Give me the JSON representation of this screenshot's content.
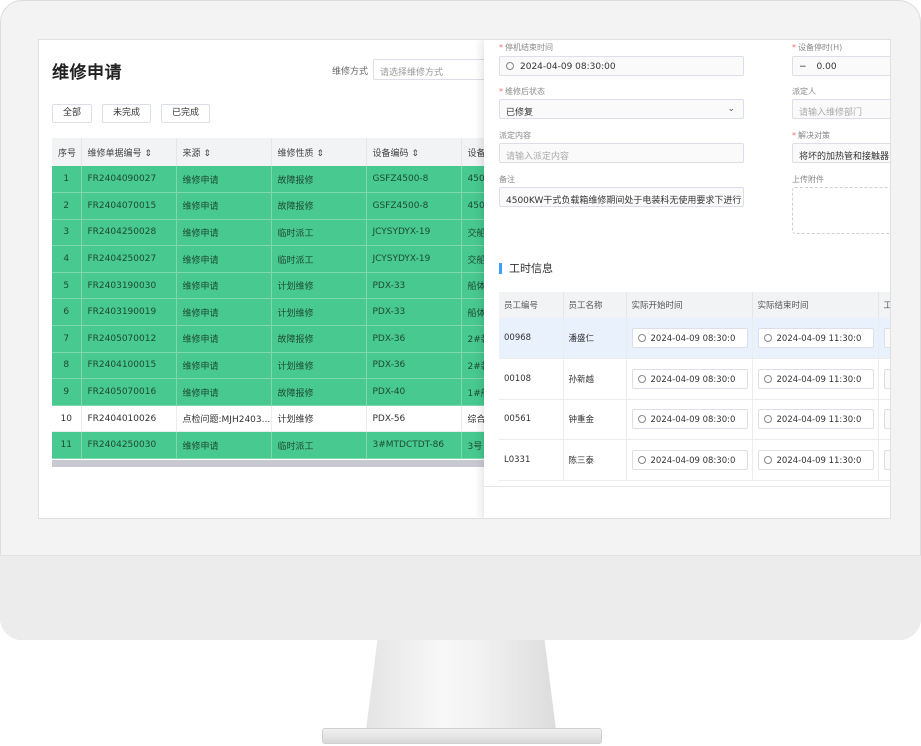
{
  "page": {
    "title": "维修申请",
    "filter_label": "维修方式",
    "filter_placeholder": "请选择维修方式",
    "tabs": [
      "全部",
      "未完成",
      "已完成"
    ]
  },
  "table": {
    "headers": [
      "序号",
      "维修单据编号 ⇕",
      "来源 ⇕",
      "维修性质 ⇕",
      "设备编码 ⇕",
      "设备"
    ],
    "rows": [
      {
        "no": "1",
        "code": "FR2404090027",
        "source": "维修申请",
        "nature": "故障报修",
        "device": "GSFZ4500-8",
        "extra": "4500",
        "color": "green"
      },
      {
        "no": "2",
        "code": "FR2404070015",
        "source": "维修申请",
        "nature": "故障报修",
        "device": "GSFZ4500-8",
        "extra": "4500",
        "color": "green"
      },
      {
        "no": "3",
        "code": "FR2404250028",
        "source": "维修申请",
        "nature": "临时派工",
        "device": "JCYSYDYX-19",
        "extra": "交船",
        "color": "green"
      },
      {
        "no": "4",
        "code": "FR2404250027",
        "source": "维修申请",
        "nature": "临时派工",
        "device": "JCYSYDYX-19",
        "extra": "交船",
        "color": "green"
      },
      {
        "no": "5",
        "code": "FR2403190030",
        "source": "维修申请",
        "nature": "计划维修",
        "device": "PDX-33",
        "extra": "船体",
        "color": "green"
      },
      {
        "no": "6",
        "code": "FR2403190019",
        "source": "维修申请",
        "nature": "计划维修",
        "device": "PDX-33",
        "extra": "船体",
        "color": "green"
      },
      {
        "no": "7",
        "code": "FR2405070012",
        "source": "维修申请",
        "nature": "故障报修",
        "device": "PDX-36",
        "extra": "2#装",
        "color": "green"
      },
      {
        "no": "8",
        "code": "FR2404100015",
        "source": "维修申请",
        "nature": "计划维修",
        "device": "PDX-36",
        "extra": "2#装",
        "color": "green"
      },
      {
        "no": "9",
        "code": "FR2405070016",
        "source": "维修申请",
        "nature": "故障报修",
        "device": "PDX-40",
        "extra": "1#船",
        "color": "green"
      },
      {
        "no": "10",
        "code": "FR2404010026",
        "source": "点检问题:MJH2403...",
        "nature": "计划维修",
        "device": "PDX-56",
        "extra": "综合",
        "color": "white"
      },
      {
        "no": "11",
        "code": "FR2404250030",
        "source": "维修申请",
        "nature": "临时派工",
        "device": "3#MTDCTDT-86",
        "extra": "3号",
        "color": "green"
      }
    ]
  },
  "form": {
    "end_time_label": "停机结束时间",
    "end_time_value": "2024-04-09 08:30:00",
    "downtime_label": "设备停时(H)",
    "downtime_minus": "−",
    "downtime_value": "0.00",
    "status_label": "维修后状态",
    "status_value": "已修复",
    "acceptor_label": "派定人",
    "acceptor_placeholder": "请输入维修部门",
    "content_label": "派定内容",
    "content_placeholder": "请输入派定内容",
    "solution_label": "解决对策",
    "solution_value": "将坏的加热管和接触器已",
    "remark_label": "备注",
    "remark_value": "4500KW干式负载箱维修期间处于电装科无使用要求下进行",
    "attach_label": "上传附件"
  },
  "work": {
    "section_title": "工时信息",
    "headers": [
      "员工编号",
      "员工名称",
      "实际开始时间",
      "实际结束时间",
      "工"
    ],
    "rows": [
      {
        "id": "00968",
        "name": "潘盛仁",
        "start": "2024-04-09 08:30:0",
        "end": "2024-04-09 11:30:0",
        "selected": true
      },
      {
        "id": "00108",
        "name": "孙新越",
        "start": "2024-04-09 08:30:0",
        "end": "2024-04-09 11:30:0",
        "selected": false
      },
      {
        "id": "00561",
        "name": "钟重金",
        "start": "2024-04-09 08:30:0",
        "end": "2024-04-09 11:30:0",
        "selected": false
      },
      {
        "id": "L0331",
        "name": "陈三泰",
        "start": "2024-04-09 08:30:0",
        "end": "2024-04-09 11:30:0",
        "selected": false
      }
    ]
  },
  "colors": {
    "row_green": "#47c98f",
    "accent_blue": "#409eff",
    "required_red": "#f56c6c"
  }
}
